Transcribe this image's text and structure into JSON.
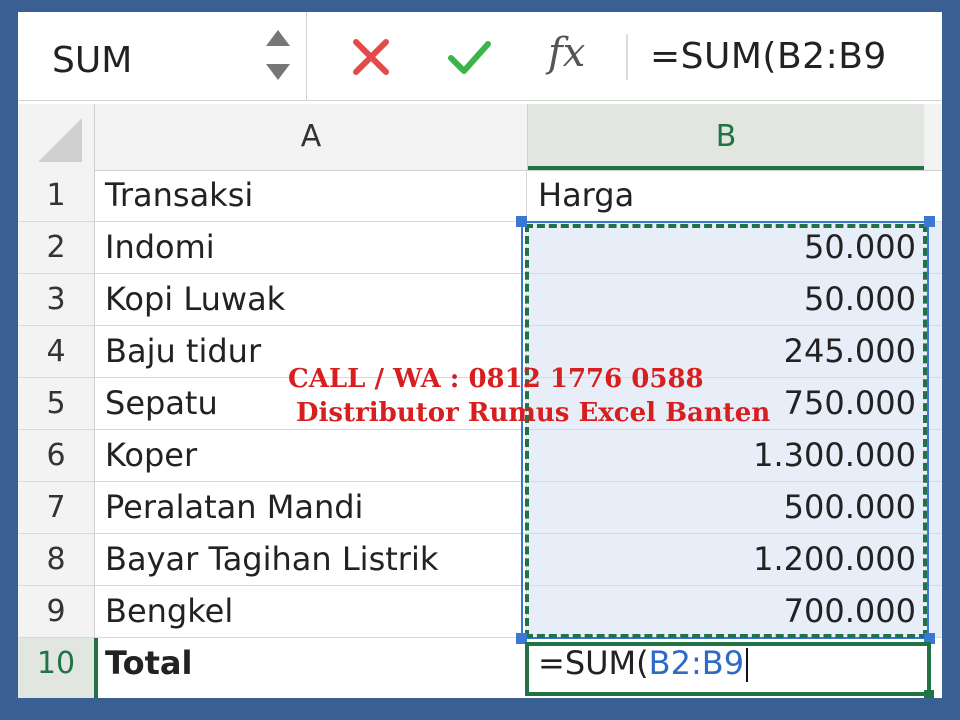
{
  "formula_bar": {
    "name_box": "SUM",
    "formula": "=SUM(B2:B9"
  },
  "icons": {
    "cancel": "x-icon",
    "confirm": "check-icon",
    "function": "fx-icon"
  },
  "function_label": "fx",
  "colors": {
    "accent": "#217346",
    "reference": "#2f6bc4",
    "cancel": "#e34b4b",
    "confirm": "#3bb54a",
    "watermark": "#d71f1f"
  },
  "grid": {
    "columns": [
      "A",
      "B"
    ],
    "rows": [
      {
        "num": "1",
        "a": "Transaksi",
        "b": "Harga"
      },
      {
        "num": "2",
        "a": "Indomi",
        "b": "50.000"
      },
      {
        "num": "3",
        "a": "Kopi Luwak",
        "b": "50.000"
      },
      {
        "num": "4",
        "a": "Baju tidur",
        "b": "245.000"
      },
      {
        "num": "5",
        "a": "Sepatu",
        "b": "750.000"
      },
      {
        "num": "6",
        "a": "Koper",
        "b": "1.300.000"
      },
      {
        "num": "7",
        "a": "Peralatan Mandi",
        "b": "500.000"
      },
      {
        "num": "8",
        "a": "Bayar Tagihan Listrik",
        "b": "1.200.000"
      },
      {
        "num": "9",
        "a": "Bengkel",
        "b": "700.000"
      }
    ],
    "total_row": {
      "num": "10",
      "a": "Total",
      "b_prefix": "=SUM(",
      "b_ref": "B2:B9"
    }
  },
  "watermark": {
    "line1": "CALL / WA : 0812 1776 0588",
    "line2": "Distributor Rumus Excel Banten"
  }
}
